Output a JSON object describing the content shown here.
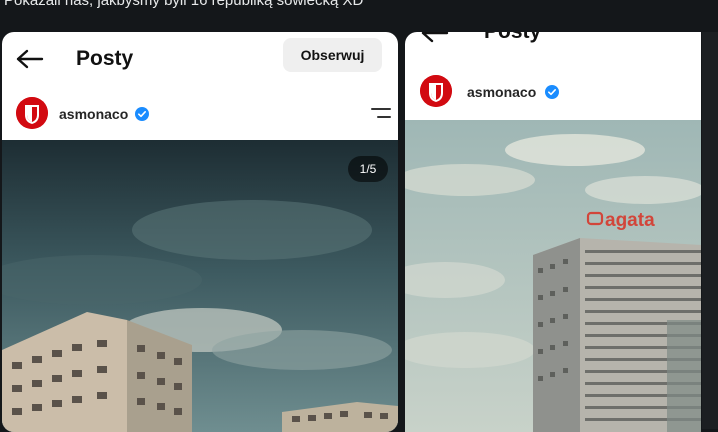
{
  "tweet": {
    "text": "Pokazali nas, jakbyśmy byli 16 republiką sowiecką XD"
  },
  "post1": {
    "title": "Posty",
    "follow_label": "Obserwuj",
    "username": "asmonaco",
    "image_counter": "1/5"
  },
  "post2": {
    "title": "Posty",
    "username": "asmonaco",
    "sign_text": "agata"
  },
  "colors": {
    "accent_blue": "#1a8cff",
    "brand_red": "#d20a11",
    "page_bg": "#14171a"
  }
}
